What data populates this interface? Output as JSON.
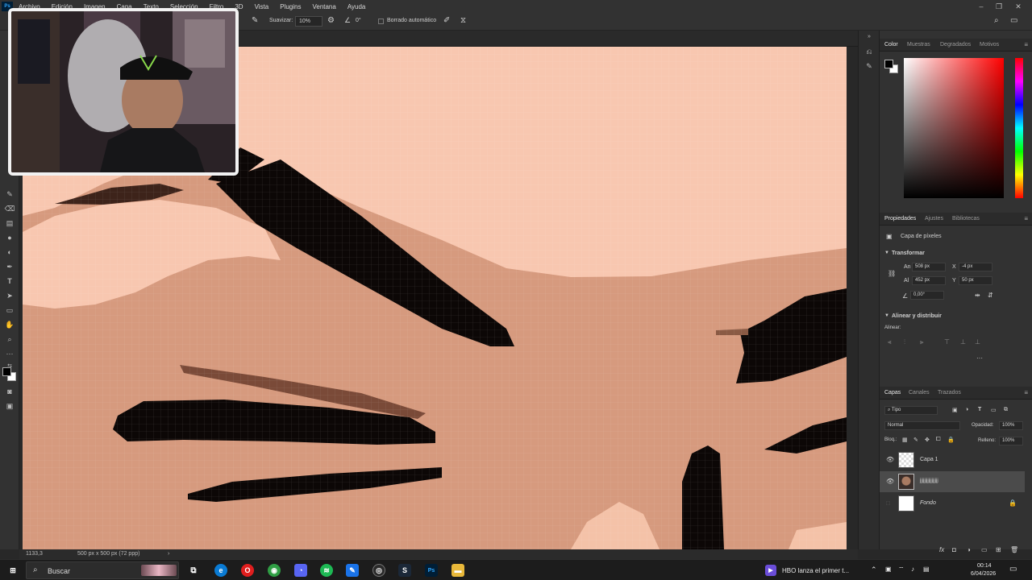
{
  "menubar": {
    "items": [
      "Archivo",
      "Edición",
      "Imagen",
      "Capa",
      "Texto",
      "Selección",
      "Filtro",
      "3D",
      "Vista",
      "Plugins",
      "Ventana",
      "Ayuda"
    ]
  },
  "options": {
    "smoothing_label": "Suavizar:",
    "smoothing_value": "10%",
    "angle_value": "0°",
    "auto_erase_label": "Borrado automático"
  },
  "status": {
    "zoom": "1133,3",
    "doc_size": "500 px x 500 px (72 ppp)"
  },
  "color_panel": {
    "tabs": [
      "Color",
      "Muestras",
      "Degradados",
      "Motivos"
    ],
    "active_tab": "Color"
  },
  "properties_panel": {
    "tabs": [
      "Propiedades",
      "Ajustes",
      "Bibliotecas"
    ],
    "layer_type": "Capa de píxeles",
    "transform_title": "Transformar",
    "w_label": "An",
    "w_value": "508 px",
    "x_label": "X",
    "x_value": "-4 px",
    "h_label": "Al",
    "h_value": "452 px",
    "y_label": "Y",
    "y_value": "50 px",
    "angle_value": "0,00°",
    "align_title": "Alinear y distribuir",
    "align_label": "Alinear:"
  },
  "layers_panel": {
    "tabs": [
      "Capas",
      "Canales",
      "Trazados"
    ],
    "filter_label": "Tipo",
    "blend_mode": "Normal",
    "opacity_label": "Opacidad:",
    "opacity_value": "100%",
    "lock_label": "Bloq.:",
    "fill_label": "Relleno:",
    "fill_value": "100%",
    "layers": [
      {
        "name": "Capa 1",
        "visible": true,
        "selected": false
      },
      {
        "name": "jjjjjjjjjjjjjjjjj",
        "visible": true,
        "selected": true
      },
      {
        "name": "Fondo",
        "visible": false,
        "selected": false
      }
    ]
  },
  "taskbar": {
    "search_placeholder": "Buscar",
    "news_text": "HBO lanza el primer t...",
    "time": "00:14",
    "date": "6/04/2026"
  }
}
